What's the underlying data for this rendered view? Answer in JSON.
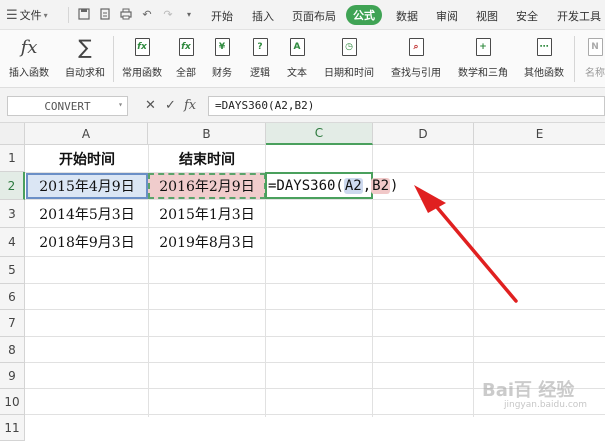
{
  "menubar": {
    "file_label": "文件",
    "tabs": [
      "开始",
      "插入",
      "页面布局",
      "公式",
      "数据",
      "审阅",
      "视图",
      "安全",
      "开发工具"
    ],
    "active_tab": "公式"
  },
  "ribbon": {
    "buttons": [
      {
        "label": "插入函数",
        "icon": "fx-icon"
      },
      {
        "label": "自动求和",
        "icon": "sigma-icon"
      },
      {
        "label": "常用函数",
        "icon": "star-function-icon"
      },
      {
        "label": "全部",
        "icon": "function-library-icon"
      },
      {
        "label": "财务",
        "icon": "finance-icon"
      },
      {
        "label": "逻辑",
        "icon": "logic-icon"
      },
      {
        "label": "文本",
        "icon": "text-function-icon"
      },
      {
        "label": "日期和时间",
        "icon": "date-time-icon"
      },
      {
        "label": "查找与引用",
        "icon": "lookup-icon"
      },
      {
        "label": "数学和三角",
        "icon": "math-trig-icon"
      },
      {
        "label": "其他函数",
        "icon": "more-functions-icon"
      },
      {
        "label": "名称",
        "icon": "name-manager-icon"
      }
    ]
  },
  "formula_bar": {
    "name_box": "CONVERT",
    "formula": "=DAYS360(A2,B2)"
  },
  "sheet": {
    "columns": [
      "A",
      "B",
      "C",
      "D",
      "E"
    ],
    "rows": [
      "1",
      "2",
      "3",
      "4",
      "5",
      "6",
      "7",
      "8",
      "9",
      "10",
      "11"
    ],
    "headers": {
      "a": "开始时间",
      "b": "结束时间"
    },
    "data": [
      {
        "start": "2015年4月9日",
        "end": "2016年2月9日"
      },
      {
        "start": "2014年5月3日",
        "end": "2015年1月3日"
      },
      {
        "start": "2018年9月3日",
        "end": "2019年8月3日"
      }
    ],
    "editing_formula": {
      "prefix": "=DAYS360(",
      "ref_a": "A2",
      "sep": ",",
      "ref_b": "B2",
      "suffix": ")"
    }
  },
  "watermark": {
    "main": "Bai百 经验",
    "sub": "jingyan.baidu.com"
  },
  "colors": {
    "accent": "#3fa354",
    "ref_a": "#dbe6f4",
    "ref_b": "#f0cccc",
    "arrow": "#e02020"
  }
}
